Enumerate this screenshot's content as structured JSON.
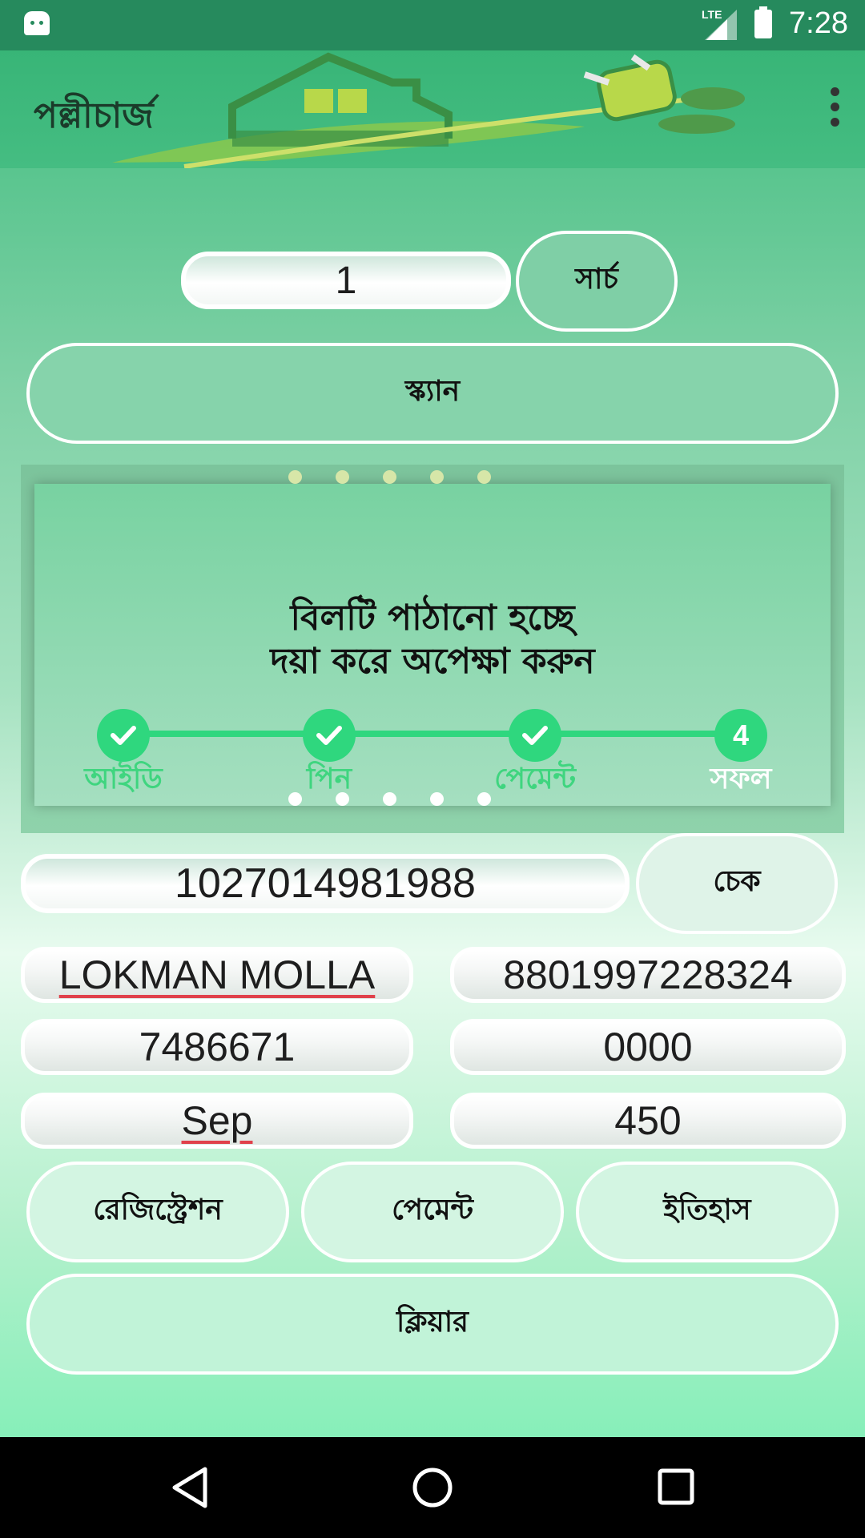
{
  "status_bar": {
    "network": "LTE",
    "time": "7:28"
  },
  "app_bar": {
    "title": "পল্লীচার্জ",
    "menu_icon": "more-vert-icon"
  },
  "search": {
    "value": "1",
    "button_label": "সার্চ"
  },
  "scan_button": "স্ক্যান",
  "progress": {
    "message_line1": "বিলটি পাঠানো হচ্ছে",
    "message_line2": "দয়া করে অপেক্ষা করুন",
    "steps": [
      {
        "label": "আইডি",
        "state": "done"
      },
      {
        "label": "পিন",
        "state": "done"
      },
      {
        "label": "পেমেন্ট",
        "state": "done"
      },
      {
        "label": "সফল",
        "number": "4",
        "state": "current"
      }
    ],
    "completed_steps": 3
  },
  "account": {
    "value": "1027014981988",
    "check_label": "চেক"
  },
  "details": {
    "name": "LOKMAN MOLLA",
    "phone": "8801997228324",
    "meter": "7486671",
    "code": "0000",
    "month": "Sep",
    "amount": "450"
  },
  "actions": {
    "registration": "রেজিস্ট্রেশন",
    "payment": "পেমেন্ট",
    "history": "ইতিহাস",
    "clear": "ক্লিয়ার"
  },
  "colors": {
    "status_bar": "#268a5d",
    "app_bar": "#3eb87c",
    "step_green": "#2fd77e",
    "label_green": "#3fd57f"
  }
}
